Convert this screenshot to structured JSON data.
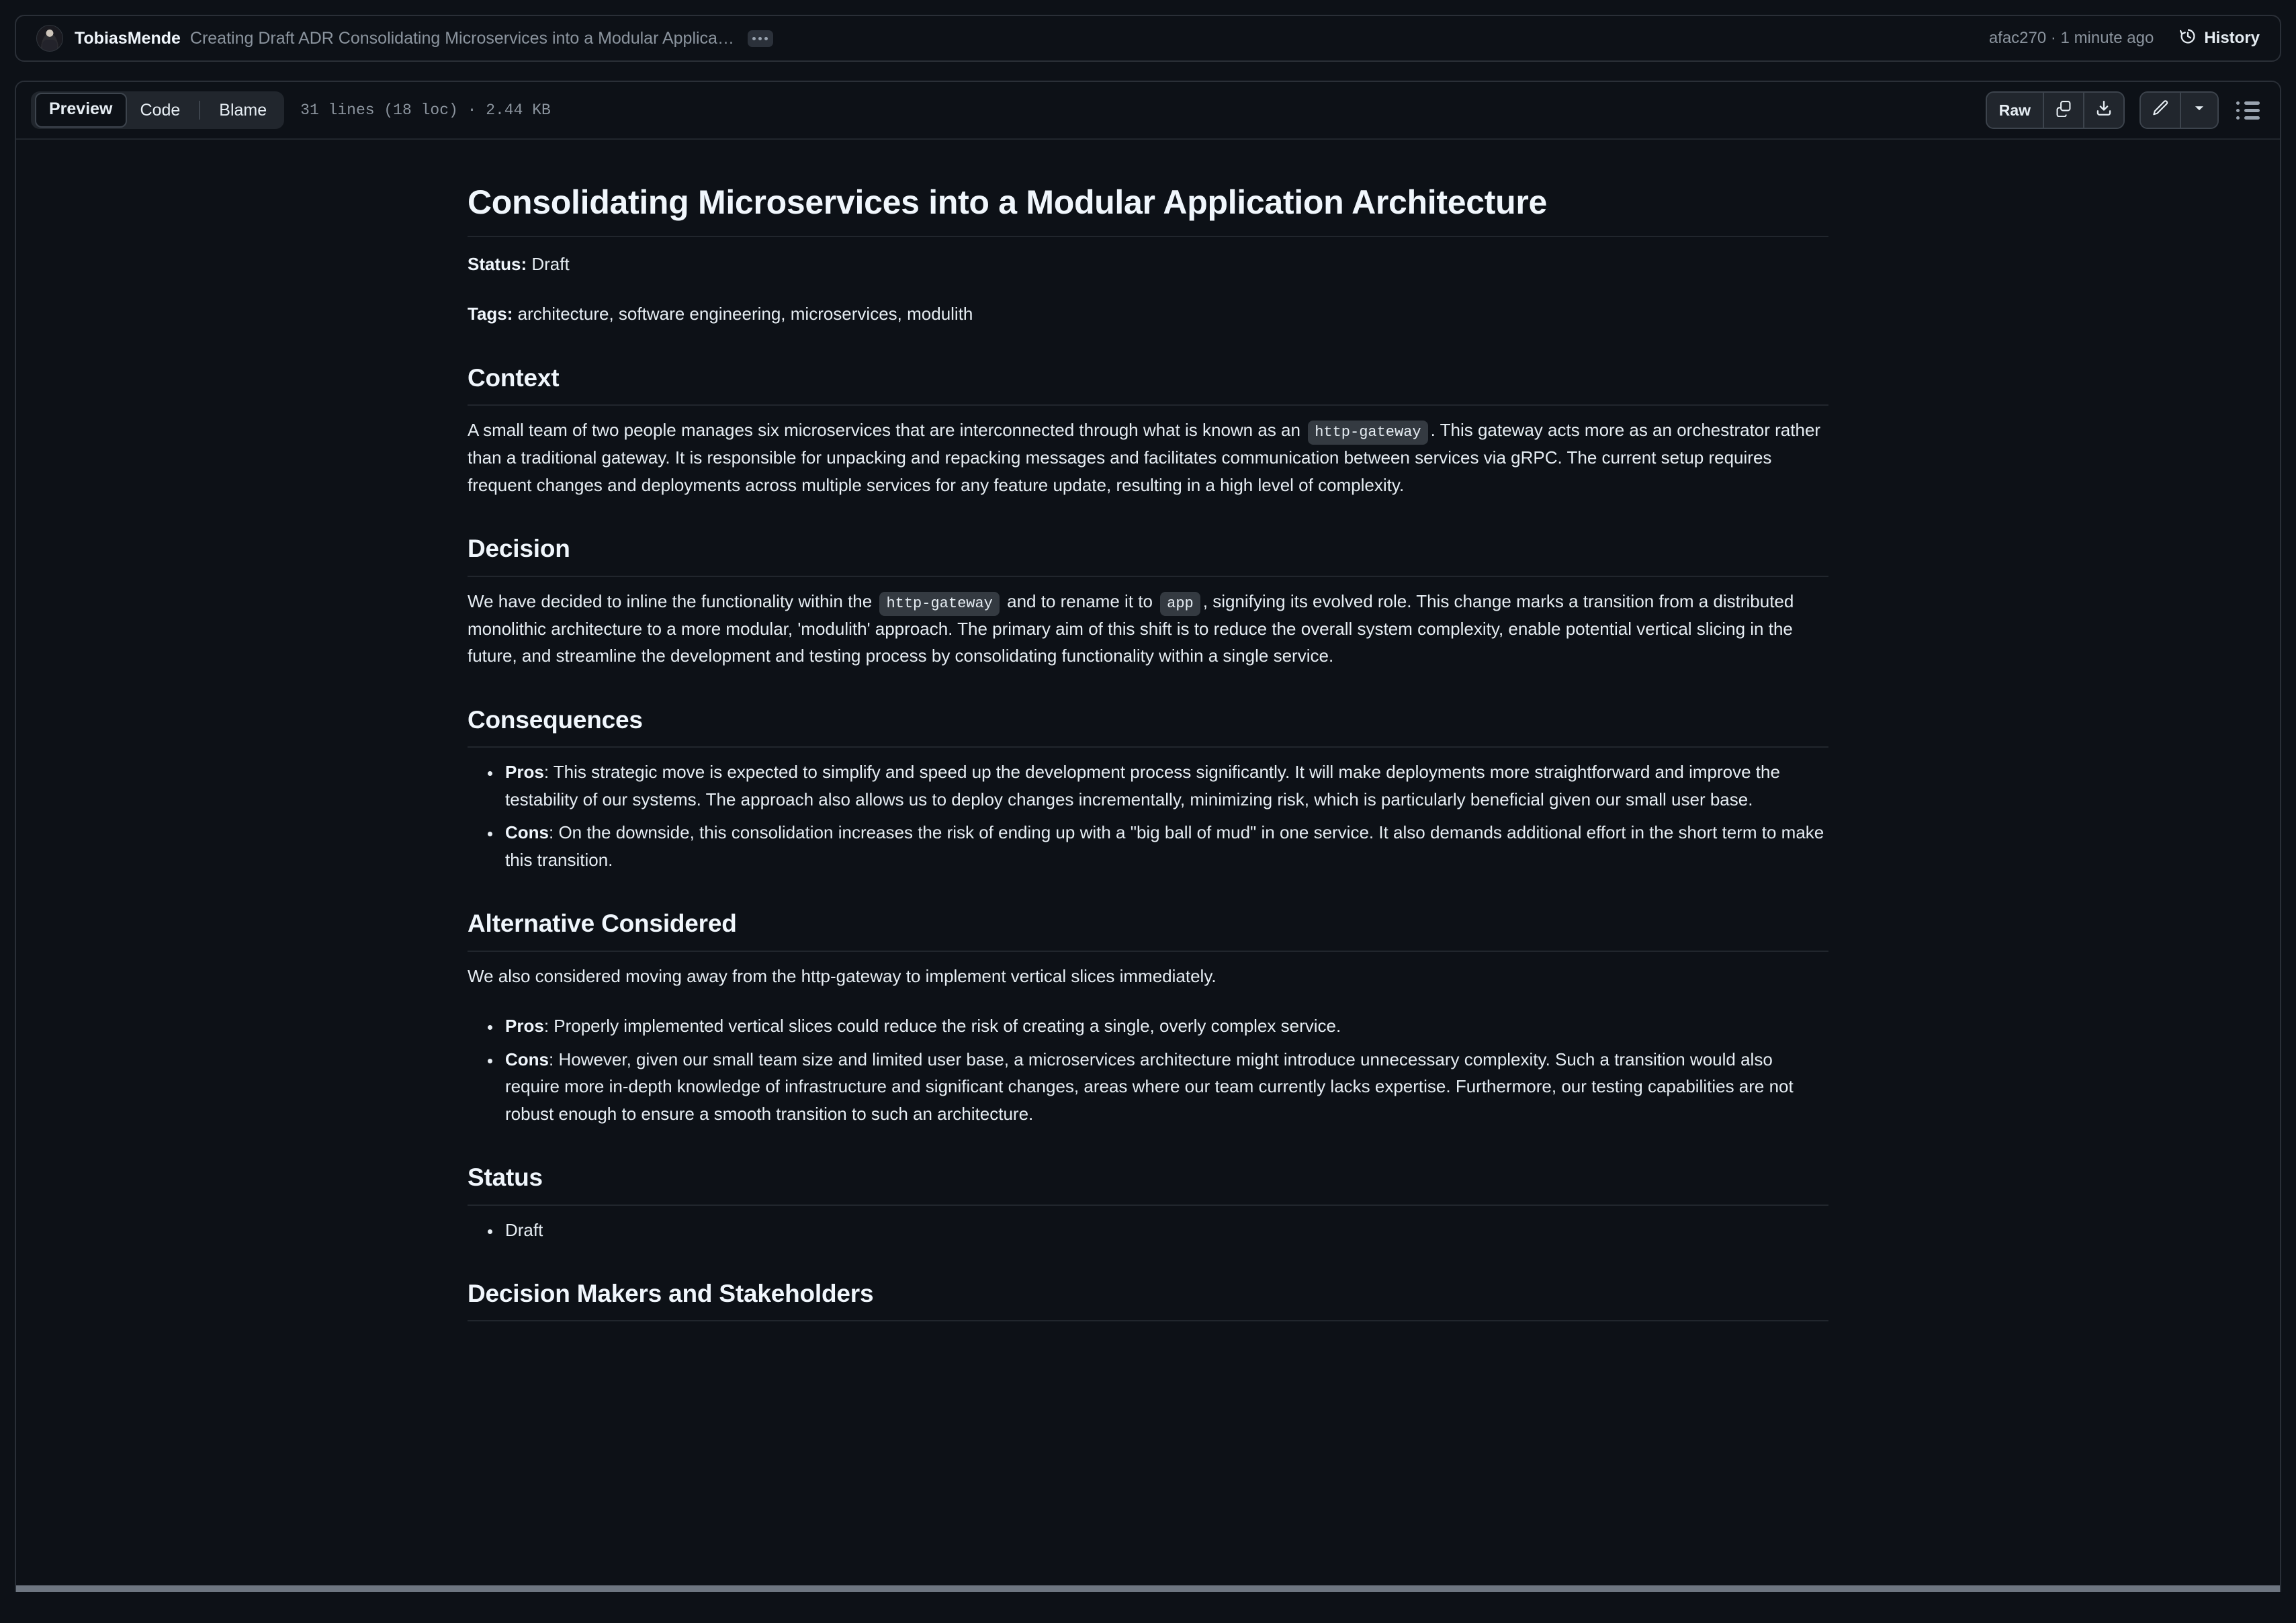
{
  "commit": {
    "author": "TobiasMende",
    "message": "Creating Draft ADR Consolidating Microservices into a Modular Applica…",
    "ellipsis_label": "•••",
    "meta": "afac270 · 1 minute ago",
    "history_label": "History",
    "icons": {
      "avatar": "avatar-image",
      "history": "history-clock-icon",
      "ellipsis": "ellipsis-badge-icon"
    }
  },
  "toolbar": {
    "tabs": [
      {
        "label": "Preview",
        "active": true
      },
      {
        "label": "Code",
        "active": false
      },
      {
        "label": "Blame",
        "active": false
      }
    ],
    "file_meta": "31 lines (18 loc) · 2.44 KB",
    "raw_label": "Raw",
    "icons": {
      "copy": "copy-icon",
      "download": "download-icon",
      "edit": "pencil-edit-icon",
      "edit_dropdown": "chevron-down-icon",
      "outline": "table-of-contents-icon"
    }
  },
  "document": {
    "title": "Consolidating Microservices into a Modular Application Architecture",
    "status_label": "Status:",
    "status_value": " Draft",
    "tags_label": "Tags:",
    "tags_value": " architecture, software engineering, microservices, modulith",
    "sections": {
      "context": {
        "heading": "Context",
        "p1_a": "A small team of two people manages six microservices that are interconnected through what is known as an ",
        "p1_code": "http-gateway",
        "p1_b": ". This gateway acts more as an orchestrator rather than a traditional gateway. It is responsible for unpacking and repacking messages and facilitates communication between services via gRPC. The current setup requires frequent changes and deployments across multiple services for any feature update, resulting in a high level of complexity."
      },
      "decision": {
        "heading": "Decision",
        "p1_a": "We have decided to inline the functionality within the ",
        "p1_code1": "http-gateway",
        "p1_b": " and to rename it to ",
        "p1_code2": "app",
        "p1_c": ", signifying its evolved role. This change marks a transition from a distributed monolithic architecture to a more modular, 'modulith' approach. The primary aim of this shift is to reduce the overall system complexity, enable potential vertical slicing in the future, and streamline the development and testing process by consolidating functionality within a single service."
      },
      "consequences": {
        "heading": "Consequences",
        "items": [
          {
            "label": "Pros",
            "text": ": This strategic move is expected to simplify and speed up the development process significantly. It will make deployments more straightforward and improve the testability of our systems. The approach also allows us to deploy changes incrementally, minimizing risk, which is particularly beneficial given our small user base."
          },
          {
            "label": "Cons",
            "text": ": On the downside, this consolidation increases the risk of ending up with a \"big ball of mud\" in one service. It also demands additional effort in the short term to make this transition."
          }
        ]
      },
      "alternative": {
        "heading": "Alternative Considered",
        "intro": "We also considered moving away from the http-gateway to implement vertical slices immediately.",
        "items": [
          {
            "label": "Pros",
            "text": ": Properly implemented vertical slices could reduce the risk of creating a single, overly complex service."
          },
          {
            "label": "Cons",
            "text": ": However, given our small team size and limited user base, a microservices architecture might introduce unnecessary complexity. Such a transition would also require more in-depth knowledge of infrastructure and significant changes, areas where our team currently lacks expertise. Furthermore, our testing capabilities are not robust enough to ensure a smooth transition to such an architecture."
          }
        ]
      },
      "status": {
        "heading": "Status",
        "items": [
          "Draft"
        ]
      },
      "stakeholders": {
        "heading": "Decision Makers and Stakeholders"
      }
    }
  },
  "colors": {
    "page_bg": "#0d1117",
    "border": "#2a2f37",
    "muted_text": "#8b949e",
    "text": "#e6edf3",
    "heading": "#f0f6fc",
    "code_bg": "#343a41",
    "control_bg": "#21262d",
    "scrollbar": "#6e7681"
  }
}
